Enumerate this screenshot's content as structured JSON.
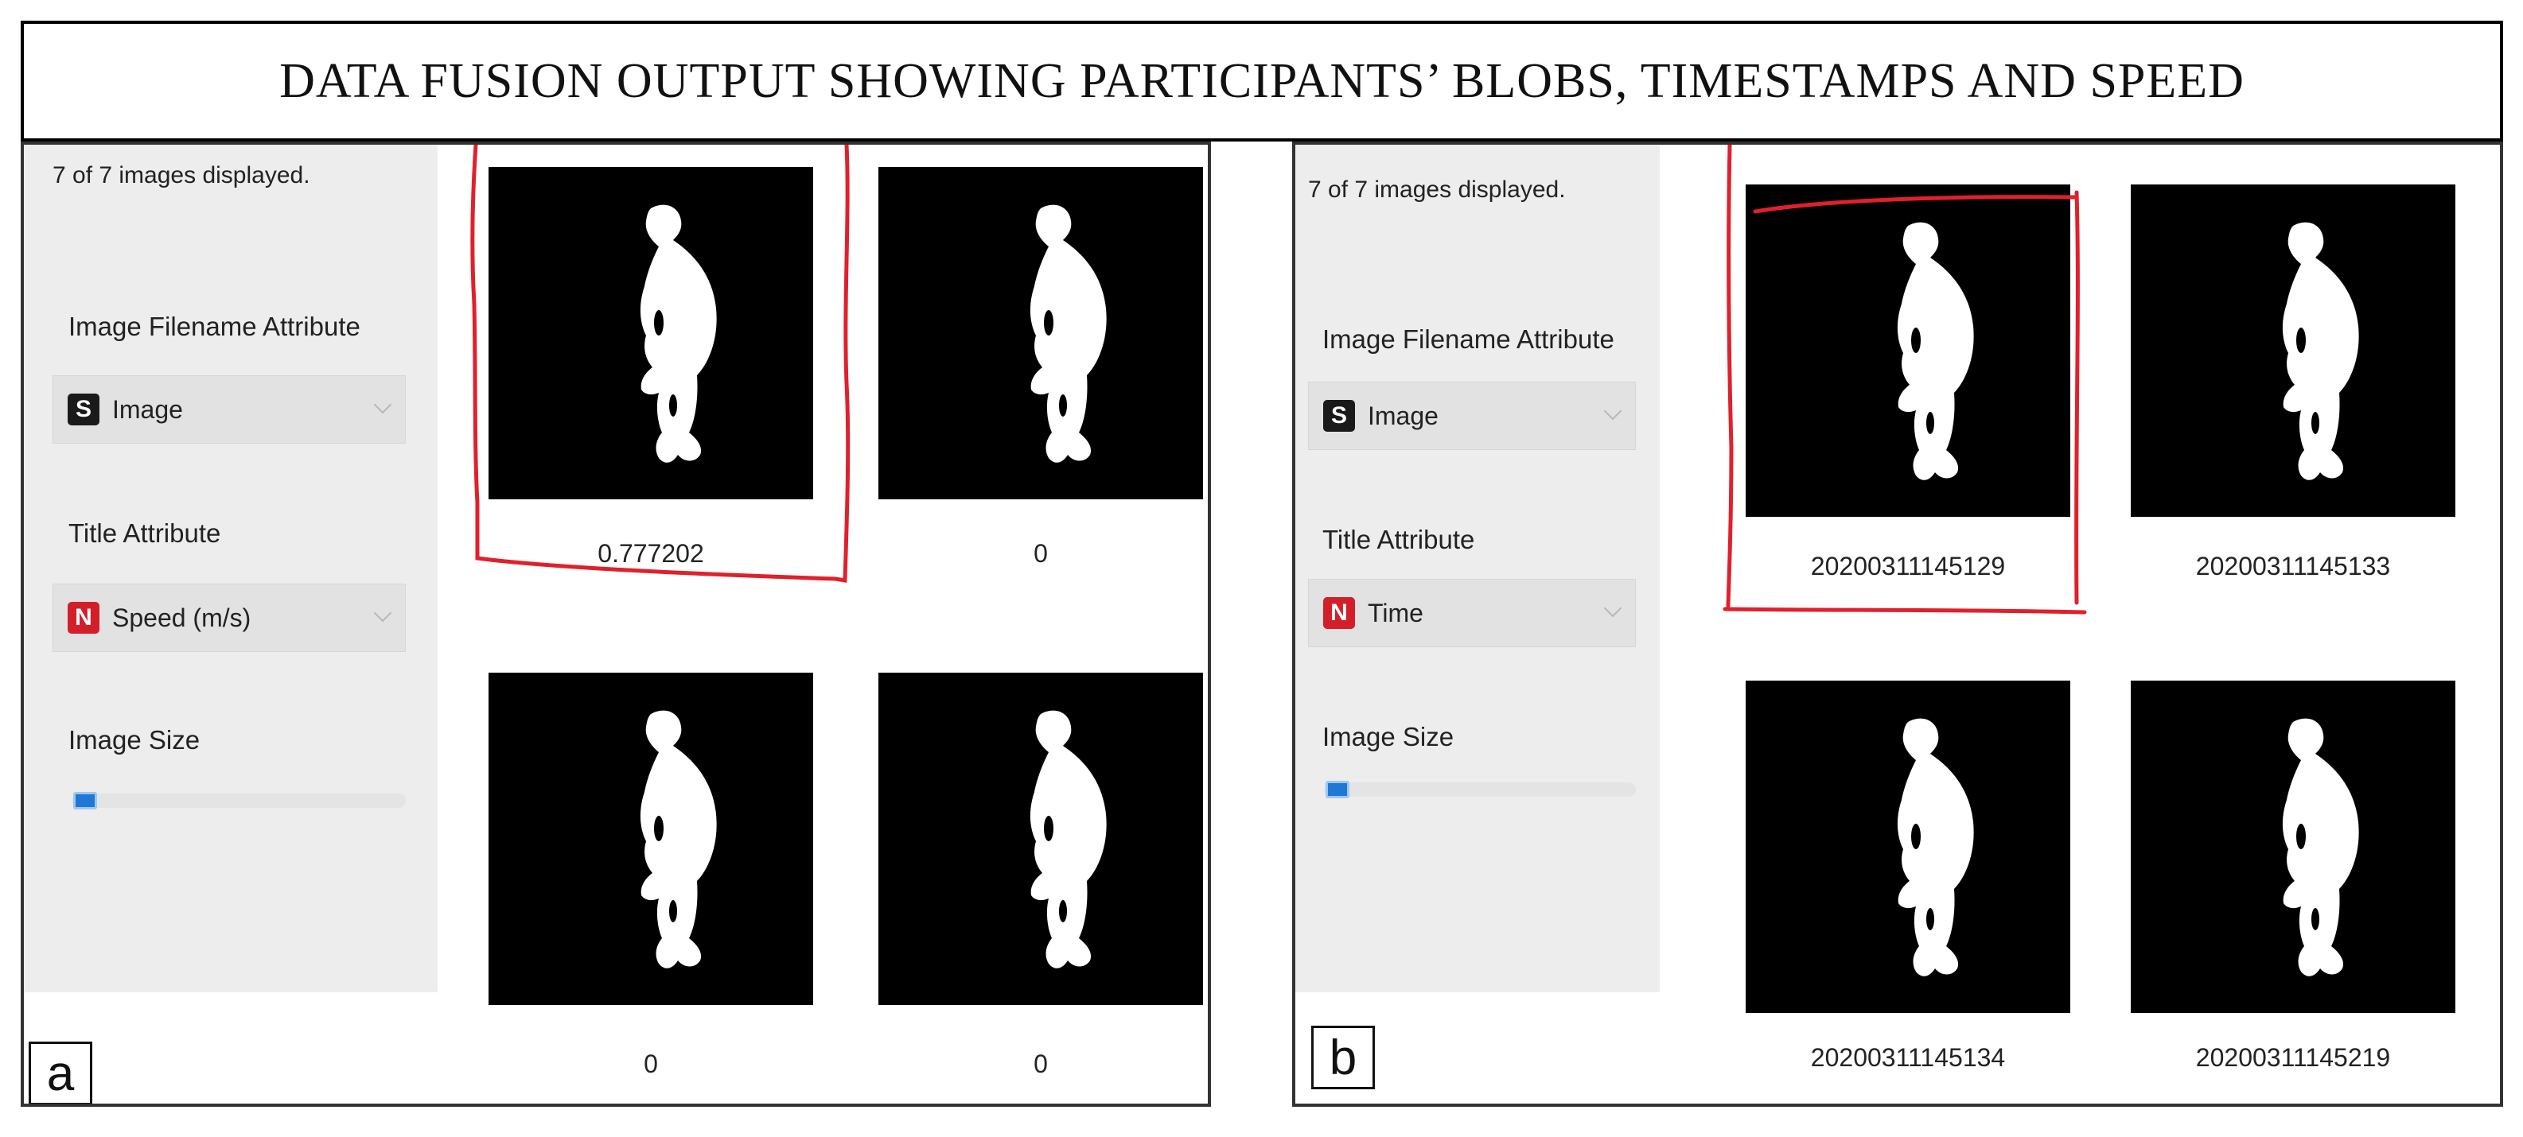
{
  "title": "DATA FUSION OUTPUT SHOWING PARTICIPANTS’ BLOBS, TIMESTAMPS AND SPEED",
  "accent": {
    "highlight": "#e0202c",
    "selection": "#1e78d4"
  },
  "panels": [
    {
      "letter": "a",
      "status": "7 of 7 images displayed.",
      "image_filename_label": "Image Filename Attribute",
      "image_badge": "S",
      "image_value": "Image",
      "title_attr_label": "Title Attribute",
      "title_badge": "N",
      "title_value": "Speed (m/s)",
      "image_size_label": "Image Size",
      "thumbnails": [
        {
          "caption": "0.777202",
          "icon": "person-blob"
        },
        {
          "caption": "0",
          "icon": "person-blob"
        },
        {
          "caption": "0",
          "icon": "person-blob"
        },
        {
          "caption": "0",
          "icon": "person-blob"
        }
      ]
    },
    {
      "letter": "b",
      "status": "7 of 7 images displayed.",
      "image_filename_label": "Image Filename Attribute",
      "image_badge": "S",
      "image_value": "Image",
      "title_attr_label": "Title Attribute",
      "title_badge": "N",
      "title_value": "Time",
      "image_size_label": "Image Size",
      "thumbnails": [
        {
          "caption": "20200311145129",
          "icon": "person-blob"
        },
        {
          "caption": "20200311145133",
          "icon": "person-blob"
        },
        {
          "caption": "20200311145134",
          "icon": "person-blob"
        },
        {
          "caption": "20200311145219",
          "icon": "person-blob"
        }
      ]
    }
  ]
}
